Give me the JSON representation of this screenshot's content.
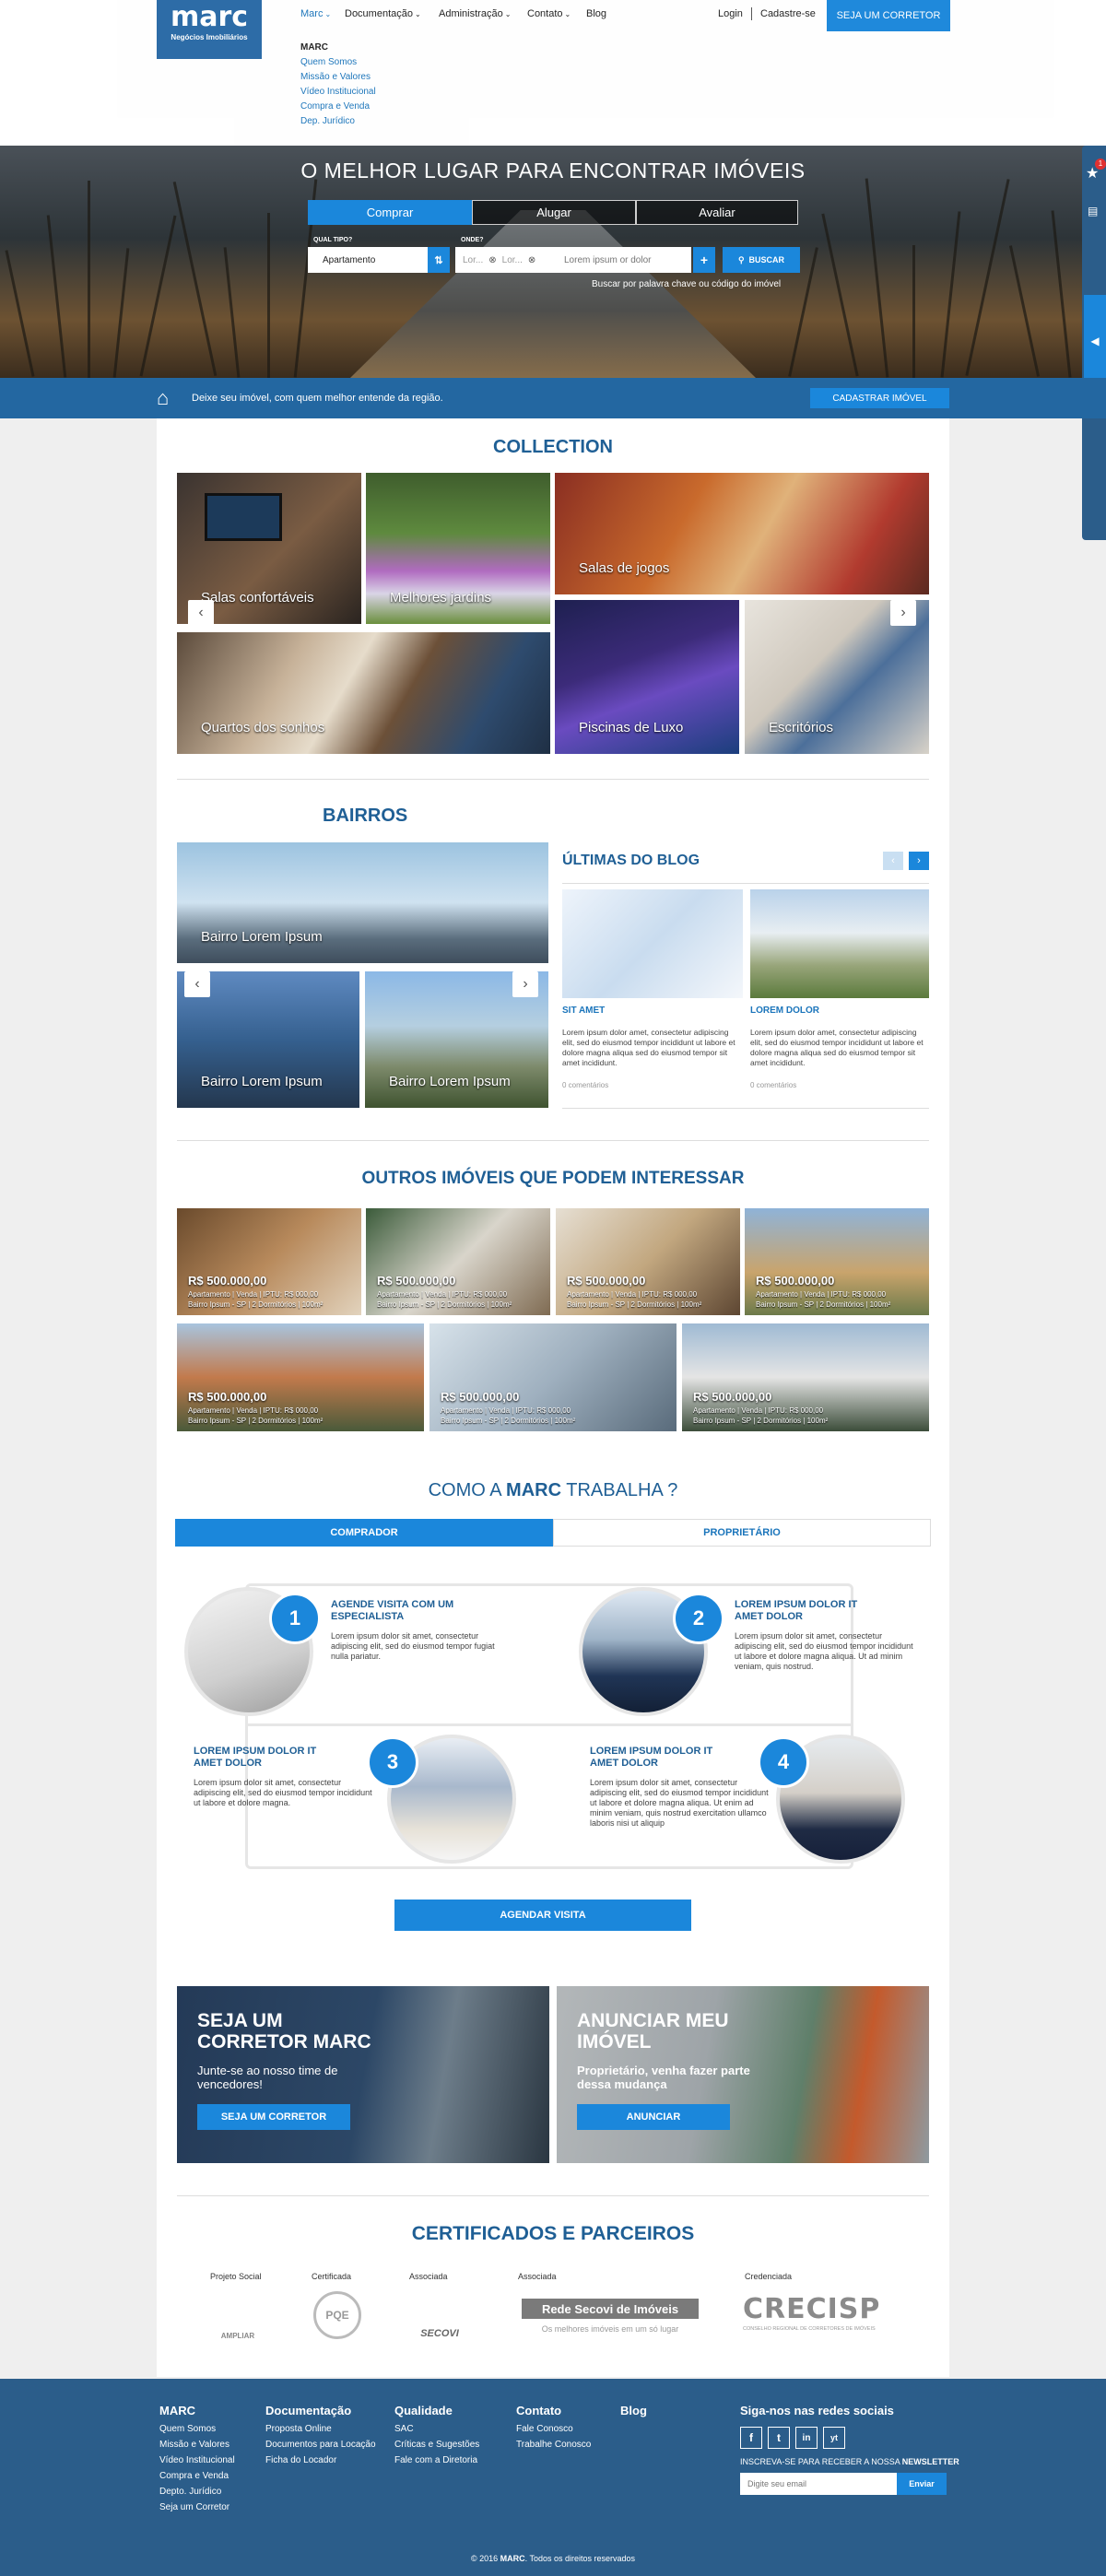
{
  "header": {
    "logo": {
      "name": "marc",
      "tagline": "Negócios Imobiliários"
    },
    "nav": [
      {
        "label": "Marc"
      },
      {
        "label": "Documentação"
      },
      {
        "label": "Administração"
      },
      {
        "label": "Contato"
      },
      {
        "label": "Blog"
      }
    ],
    "login": "Login",
    "signup": "Cadastre-se",
    "cta": "SEJA UM CORRETOR",
    "submenu": {
      "title": "MARC",
      "items": [
        "Quem Somos",
        "Missão e Valores",
        "Vídeo Institucional",
        "Compra e Venda",
        "Dep. Jurídico"
      ]
    }
  },
  "hero": {
    "title": "O MELHOR LUGAR PARA ENCONTRAR IMÓVEIS",
    "tabs": [
      "Comprar",
      "Alugar",
      "Avaliar"
    ],
    "type_label": "QUAL TIPO?",
    "type_value": "Apartamento",
    "where_label": "ONDE?",
    "chips": [
      "Lor...",
      "Lor..."
    ],
    "search_placeholder": "Lorem ipsum or dolor",
    "plus": "+",
    "search_button": "BUSCAR",
    "keyword_link": "Buscar por palavra chave ou código do imóvel"
  },
  "band": {
    "text": "Deixe seu imóvel, com quem melhor entende da região.",
    "button": "CADASTRAR IMÓVEL"
  },
  "collection": {
    "title": "COLLECTION",
    "tiles": [
      "Salas confortáveis",
      "Melhores jardins",
      "Salas de jogos",
      "Quartos dos sonhos",
      "Piscinas de Luxo",
      "Escritórios"
    ]
  },
  "bairros": {
    "title": "BAIRROS",
    "tiles": [
      "Bairro Lorem Ipsum",
      "Bairro Lorem Ipsum",
      "Bairro Lorem Ipsum"
    ]
  },
  "blog": {
    "title": "ÚLTIMAS DO BLOG",
    "posts": [
      {
        "title": "SIT AMET",
        "text": "Lorem ipsum dolor amet, consectetur adipiscing elit, sed do eiusmod tempor incididunt ut labore et dolore magna aliqua sed do eiusmod tempor sit amet incididunt.",
        "comments": "0 comentários"
      },
      {
        "title": "LOREM DOLOR",
        "text": "Lorem ipsum dolor amet, consectetur adipiscing elit, sed do eiusmod tempor incididunt ut labore et dolore magna aliqua sed do eiusmod tempor sit amet incididunt.",
        "comments": "0 comentários"
      }
    ]
  },
  "outros": {
    "title": "OUTROS IMÓVEIS QUE PODEM INTERESSAR",
    "price": "R$ 500.000,00",
    "line1": "Apartamento | Venda | IPTU: R$ 000,00",
    "line2": "Bairro Ipsum - SP | 2 Dormitórios | 100m²"
  },
  "como": {
    "title_pre": "COMO A ",
    "title_brand": "MARC",
    "title_post": " TRABALHA ?",
    "tabs": [
      "COMPRADOR",
      "PROPRIETÁRIO"
    ],
    "steps": [
      {
        "n": "1",
        "title": "AGENDE VISITA COM UM ESPECIALISTA",
        "text": "Lorem ipsum dolor sit amet, consectetur adipiscing elit, sed do eiusmod tempor fugiat nulla pariatur."
      },
      {
        "n": "2",
        "title": "LOREM IPSUM DOLOR IT AMET DOLOR",
        "text": "Lorem ipsum dolor sit amet, consectetur adipiscing elit, sed do eiusmod tempor incididunt ut labore et dolore magna aliqua. Ut ad minim veniam, quis nostrud."
      },
      {
        "n": "3",
        "title": "LOREM IPSUM DOLOR IT AMET DOLOR",
        "text": "Lorem ipsum dolor sit amet, consectetur adipiscing elit, sed do eiusmod tempor incididunt ut labore et dolore magna."
      },
      {
        "n": "4",
        "title": "LOREM IPSUM DOLOR IT AMET DOLOR",
        "text": "Lorem ipsum dolor sit amet, consectetur adipiscing elit, sed do eiusmod tempor incididunt ut labore et dolore magna aliqua. Ut enim ad minim veniam, quis nostrud exercitation ullamco laboris nisi ut aliquip"
      }
    ],
    "button": "AGENDAR VISITA"
  },
  "promos": [
    {
      "title": "SEJA UM CORRETOR MARC",
      "sub": "Junte-se ao nosso time de vencedores!",
      "button": "SEJA UM CORRETOR"
    },
    {
      "title": "ANUNCIAR MEU IMÓVEL",
      "sub": "Proprietário, venha fazer parte dessa mudança",
      "button": "ANUNCIAR"
    }
  ],
  "partners": {
    "title": "CERTIFICADOS E PARCEIROS",
    "items": [
      {
        "label": "Projeto Social",
        "logo": "AMPLIAR"
      },
      {
        "label": "Certificada",
        "logo": "PQE"
      },
      {
        "label": "Associada",
        "logo": "SECOVI"
      },
      {
        "label": "Associada",
        "logo": "Rede Secovi de Imóveis",
        "sub": "Os melhores imóveis em um só lugar"
      },
      {
        "label": "Credenciada",
        "logo": "CRECISP",
        "sub": "CONSELHO REGIONAL DE CORRETORES DE IMÓVEIS"
      }
    ]
  },
  "footer": {
    "cols": [
      {
        "title": "MARC",
        "items": [
          "Quem Somos",
          "Missão e Valores",
          "Vídeo Institucional",
          "Compra e Venda",
          "Depto. Jurídico",
          "Seja um Corretor"
        ]
      },
      {
        "title": "Documentação",
        "items": [
          "Proposta Online",
          "Documentos para Locação",
          "Ficha do Locador"
        ]
      },
      {
        "title": "Qualidade",
        "items": [
          "SAC",
          "Críticas e Sugestões",
          "Fale com a Diretoria"
        ]
      },
      {
        "title": "Contato",
        "items": [
          "Fale Conosco",
          "Trabalhe Conosco"
        ]
      },
      {
        "title": "Blog",
        "items": []
      }
    ],
    "social_title": "Siga-nos nas redes sociais",
    "social": [
      "f",
      "t",
      "in",
      "yt"
    ],
    "newsletter_pre": "INSCREVA-SE PARA RECEBER A NOSSA ",
    "newsletter_strong": "NEWSLETTER",
    "email_placeholder": "Digite seu email",
    "send": "Enviar",
    "copy_pre": "© 2016 ",
    "copy_brand": "MARC",
    "copy_post": ". Todos os direitos reservados"
  },
  "side": {
    "badge": "1"
  },
  "colors": {
    "primary": "#1b87db",
    "dark": "#1f5f95",
    "footer": "#2b5d8a"
  }
}
